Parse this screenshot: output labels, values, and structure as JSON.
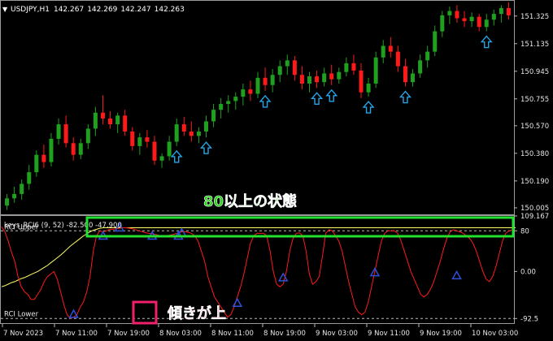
{
  "chart_data": [
    {
      "type": "candlestick",
      "header": {
        "symbol": "USDJPY,H1",
        "open": "142.267",
        "high": "142.269",
        "low": "142.247",
        "close": "142.263"
      },
      "ylim": [
        149.96,
        151.43
      ],
      "y_ticks": [
        "151.325",
        "151.135",
        "150.945",
        "150.755",
        "150.570",
        "150.380",
        "150.190",
        "150.005"
      ],
      "colors": {
        "up": "#1fa01f",
        "down": "#ff1a1a",
        "arrow": "#26a4e6"
      },
      "candles": [
        [
          150.02,
          150.1,
          149.99,
          150.07
        ],
        [
          150.07,
          150.15,
          150.04,
          150.1
        ],
        [
          150.1,
          150.2,
          150.06,
          150.17
        ],
        [
          150.17,
          150.3,
          150.13,
          150.25
        ],
        [
          150.25,
          150.4,
          150.22,
          150.37
        ],
        [
          150.37,
          150.44,
          150.28,
          150.32
        ],
        [
          150.32,
          150.52,
          150.29,
          150.48
        ],
        [
          150.48,
          150.62,
          150.44,
          150.58
        ],
        [
          150.58,
          150.64,
          150.42,
          150.45
        ],
        [
          150.45,
          150.49,
          150.33,
          150.37
        ],
        [
          150.37,
          150.48,
          150.34,
          150.45
        ],
        [
          150.45,
          150.58,
          150.41,
          150.55
        ],
        [
          150.55,
          150.7,
          150.5,
          150.66
        ],
        [
          150.66,
          150.78,
          150.58,
          150.62
        ],
        [
          150.62,
          150.67,
          150.55,
          150.58
        ],
        [
          150.58,
          150.66,
          150.52,
          150.64
        ],
        [
          150.64,
          150.68,
          150.5,
          150.53
        ],
        [
          150.53,
          150.56,
          150.4,
          150.43
        ],
        [
          150.43,
          150.52,
          150.37,
          150.49
        ],
        [
          150.49,
          150.54,
          150.42,
          150.46
        ],
        [
          150.46,
          150.5,
          150.3,
          150.33
        ],
        [
          150.33,
          150.38,
          150.28,
          150.36
        ],
        [
          150.36,
          150.5,
          150.33,
          150.46
        ],
        [
          150.46,
          150.62,
          150.43,
          150.58
        ],
        [
          150.58,
          150.63,
          150.5,
          150.53
        ],
        [
          150.53,
          150.6,
          150.46,
          150.5
        ],
        [
          150.5,
          150.56,
          150.45,
          150.53
        ],
        [
          150.53,
          150.64,
          150.49,
          150.6
        ],
        [
          150.6,
          150.72,
          150.56,
          150.68
        ],
        [
          150.68,
          150.76,
          150.62,
          150.72
        ],
        [
          150.72,
          150.78,
          150.66,
          150.74
        ],
        [
          150.74,
          150.8,
          150.68,
          150.77
        ],
        [
          150.77,
          150.86,
          150.71,
          150.82
        ],
        [
          150.82,
          150.88,
          150.74,
          150.79
        ],
        [
          150.79,
          150.94,
          150.76,
          150.9
        ],
        [
          150.9,
          150.97,
          150.81,
          150.85
        ],
        [
          150.85,
          150.96,
          150.8,
          150.92
        ],
        [
          150.92,
          151.02,
          150.87,
          150.98
        ],
        [
          150.98,
          151.06,
          150.92,
          151.02
        ],
        [
          151.02,
          151.05,
          150.88,
          150.92
        ],
        [
          150.92,
          150.98,
          150.82,
          150.86
        ],
        [
          150.86,
          150.94,
          150.8,
          150.91
        ],
        [
          150.91,
          150.95,
          150.83,
          150.87
        ],
        [
          150.87,
          150.97,
          150.84,
          150.93
        ],
        [
          150.93,
          150.99,
          150.85,
          150.89
        ],
        [
          150.89,
          150.97,
          150.86,
          150.94
        ],
        [
          150.94,
          151.04,
          150.91,
          151.0
        ],
        [
          151.0,
          151.06,
          150.92,
          150.95
        ],
        [
          150.95,
          151.0,
          150.76,
          150.8
        ],
        [
          150.8,
          150.9,
          150.77,
          150.86
        ],
        [
          150.86,
          151.08,
          150.83,
          151.04
        ],
        [
          151.04,
          151.16,
          151.0,
          151.12
        ],
        [
          151.12,
          151.18,
          151.04,
          151.08
        ],
        [
          151.08,
          151.12,
          150.94,
          150.98
        ],
        [
          150.98,
          151.03,
          150.84,
          150.87
        ],
        [
          150.87,
          150.96,
          150.84,
          150.93
        ],
        [
          150.93,
          151.06,
          150.9,
          151.02
        ],
        [
          151.02,
          151.12,
          150.97,
          151.08
        ],
        [
          151.08,
          151.26,
          151.05,
          151.22
        ],
        [
          151.22,
          151.36,
          151.18,
          151.33
        ],
        [
          151.33,
          151.39,
          151.27,
          151.36
        ],
        [
          151.36,
          151.4,
          151.28,
          151.31
        ],
        [
          151.31,
          151.36,
          151.25,
          151.29
        ],
        [
          151.29,
          151.35,
          151.25,
          151.32
        ],
        [
          151.32,
          151.34,
          151.22,
          151.25
        ],
        [
          151.25,
          151.34,
          151.22,
          151.3
        ],
        [
          151.3,
          151.37,
          151.26,
          151.34
        ],
        [
          151.34,
          151.4,
          151.28,
          151.38
        ],
        [
          151.38,
          151.42,
          151.3,
          151.33
        ]
      ],
      "arrow_candles": [
        23,
        27,
        35,
        42,
        44,
        49,
        54,
        65
      ]
    },
    {
      "type": "line",
      "indicator_label": "keys_RCI6 (9, 52) -82.500 -47.900",
      "ylim": [
        -100,
        109.167
      ],
      "y_ticks": [
        "109.167",
        "80",
        "0.00",
        "-92.5"
      ],
      "levels": {
        "upper": 80,
        "lower": -92.5
      },
      "upper_label": "RCI Upper",
      "lower_label": "RCI Lower",
      "series": [
        {
          "color": "#ff1a1a",
          "values": [
            88,
            78,
            60,
            38,
            20,
            -10,
            -30,
            -40,
            -45,
            -55,
            -55,
            -45,
            -35,
            -20,
            -10,
            -5,
            0,
            -15,
            -40,
            -65,
            -85,
            -92,
            -90,
            -85,
            -70,
            -60,
            -40,
            -10,
            40,
            70,
            80,
            78,
            80,
            83,
            83,
            84,
            85,
            86,
            86,
            85,
            84,
            82,
            80,
            78,
            76,
            75,
            74,
            73,
            71,
            70,
            70,
            71,
            72,
            74,
            76,
            78,
            78,
            77,
            75,
            70,
            60,
            40,
            20,
            -10,
            -30,
            -50,
            -60,
            -70,
            -80,
            -90,
            -85,
            -70,
            -50,
            -30,
            -5,
            25,
            55,
            70,
            75,
            75,
            75,
            70,
            40,
            0,
            -25,
            -30,
            -25,
            0,
            40,
            65,
            75,
            76,
            70,
            40,
            -5,
            -25,
            -20,
            -10,
            30,
            75,
            82,
            80,
            70,
            60,
            40,
            10,
            -20,
            -45,
            -70,
            -80,
            -85,
            -80,
            -60,
            -30,
            0,
            30,
            60,
            75,
            80,
            80,
            80,
            75,
            60,
            40,
            20,
            0,
            -15,
            -30,
            -45,
            -50,
            -45,
            -35,
            -20,
            0,
            20,
            45,
            65,
            78,
            82,
            80,
            78,
            75,
            70,
            65,
            55,
            40,
            20,
            0,
            -15,
            -20,
            -10,
            10,
            35,
            60,
            75,
            80,
            82
          ]
        },
        {
          "color": "#ffff66",
          "values": [
            -30,
            -28,
            -25,
            -22,
            -20,
            -17,
            -14,
            -12,
            -9,
            -6,
            -3,
            0,
            4,
            8,
            12,
            17,
            22,
            27,
            32,
            38,
            44,
            50,
            55,
            60,
            65,
            70,
            74,
            78,
            81,
            83,
            85,
            86,
            86,
            86,
            86,
            86,
            86,
            86,
            86,
            86,
            86,
            86,
            86,
            86,
            86,
            86,
            86,
            86,
            86,
            86,
            86,
            86,
            86,
            86,
            86,
            86,
            86,
            86,
            86,
            86,
            86,
            86,
            86,
            86,
            86,
            86,
            86,
            86,
            86,
            86,
            86,
            86,
            86,
            86,
            86,
            86,
            86,
            86,
            86,
            86,
            86,
            86,
            86,
            86,
            86,
            86,
            86,
            86,
            86,
            86,
            86,
            86,
            86,
            86,
            86,
            86,
            86,
            86,
            86,
            86,
            86,
            86,
            86,
            86,
            86,
            86,
            86,
            86,
            86,
            86,
            86,
            86,
            86,
            86,
            86,
            86,
            86,
            86,
            86,
            86,
            86,
            86,
            86,
            86,
            86,
            86,
            86,
            86,
            86,
            86,
            86,
            86,
            86,
            86,
            86,
            86,
            86,
            86,
            86,
            86,
            86,
            86,
            86,
            86,
            86,
            86,
            86,
            86,
            86,
            86,
            86,
            86,
            86,
            86,
            86,
            86,
            86,
            86
          ]
        }
      ],
      "markers": [
        {
          "index": 22,
          "value": -84
        },
        {
          "index": 31,
          "value": 70
        },
        {
          "index": 36,
          "value": 86
        },
        {
          "index": 46,
          "value": 70
        },
        {
          "index": 54,
          "value": 70
        },
        {
          "index": 55,
          "value": 76
        },
        {
          "index": 72,
          "value": -62
        },
        {
          "index": 86,
          "value": -12
        },
        {
          "index": 114,
          "value": -2
        },
        {
          "index": 139,
          "value": -8
        }
      ]
    }
  ],
  "x_axis": {
    "labels": [
      "7 Nov 2023",
      "7 Nov 11:00",
      "7 Nov 19:00",
      "8 Nov 03:00",
      "8 Nov 11:00",
      "8 Nov 19:00",
      "9 Nov 03:00",
      "9 Nov 11:00",
      "9 Nov 19:00",
      "10 Nov 03:00"
    ]
  },
  "annotations": {
    "state_text": "80以上の状態",
    "slope_text": "傾きが上"
  }
}
